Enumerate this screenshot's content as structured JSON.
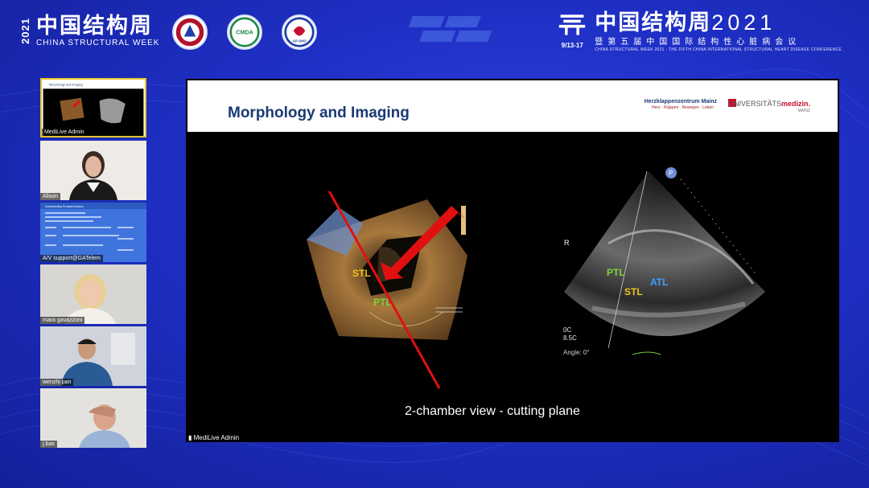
{
  "header": {
    "year_vertical": "2021",
    "brand_cn": "中国结构周",
    "brand_en": "CHINA STRUCTURAL WEEK",
    "right_date": "9/13-17",
    "right_cn": "中国结构周",
    "right_year": "2021",
    "right_sub_cn": "暨第五届中国国际结构性心脏病会议",
    "right_en": "CHINA STRUCTURAL WEEK 2021 · THE FIFTH CHINA INTERNATIONAL STRUCTURAL HEART DISEASE CONFERENCE",
    "logo2_text": "CMDA",
    "logo3_text": "AP-SHD"
  },
  "participants": [
    {
      "name": "MediLive Admin",
      "kind": "slide-thumb",
      "thumb_title": "Morphology and Imaging"
    },
    {
      "name": "Alison",
      "kind": "person"
    },
    {
      "name": "A/V support@GATelem",
      "kind": "program",
      "program_title": "Understanding Tricuspid Anatomy"
    },
    {
      "name": "mara gavazzoni",
      "kind": "person"
    },
    {
      "name": "wenzhi pan",
      "kind": "person"
    },
    {
      "name": "j.bax",
      "kind": "person"
    }
  ],
  "slide": {
    "title": "Morphology and Imaging",
    "institution1": "Herzklappenzentrum Mainz",
    "institution1_sub": "Herz · Klappen · Bewegen · Leben",
    "institution2_prefix": "UNIVERSITÄTS",
    "institution2_bold": "medizin.",
    "institution2_sub": "MAINZ",
    "labels_3d": {
      "stl": "STL",
      "ptl": "PTL"
    },
    "labels_echo": {
      "r": "R",
      "ptl": "PTL",
      "stl": "STL",
      "atl": "ATL",
      "p": "P",
      "depth1": "0C",
      "depth2": "8.5C",
      "angle": "Angle: 0°"
    },
    "caption": "2-chamber view - cutting plane",
    "host_tag": "MediLive Admin"
  },
  "colors": {
    "background": "#1e2fc4",
    "slide_title": "#1b3a73",
    "arrow": "#e01010",
    "label_yellow": "#f2c21a",
    "label_green": "#7fd63a",
    "label_blue": "#3aa0ff",
    "active_border": "#e8c22c"
  }
}
